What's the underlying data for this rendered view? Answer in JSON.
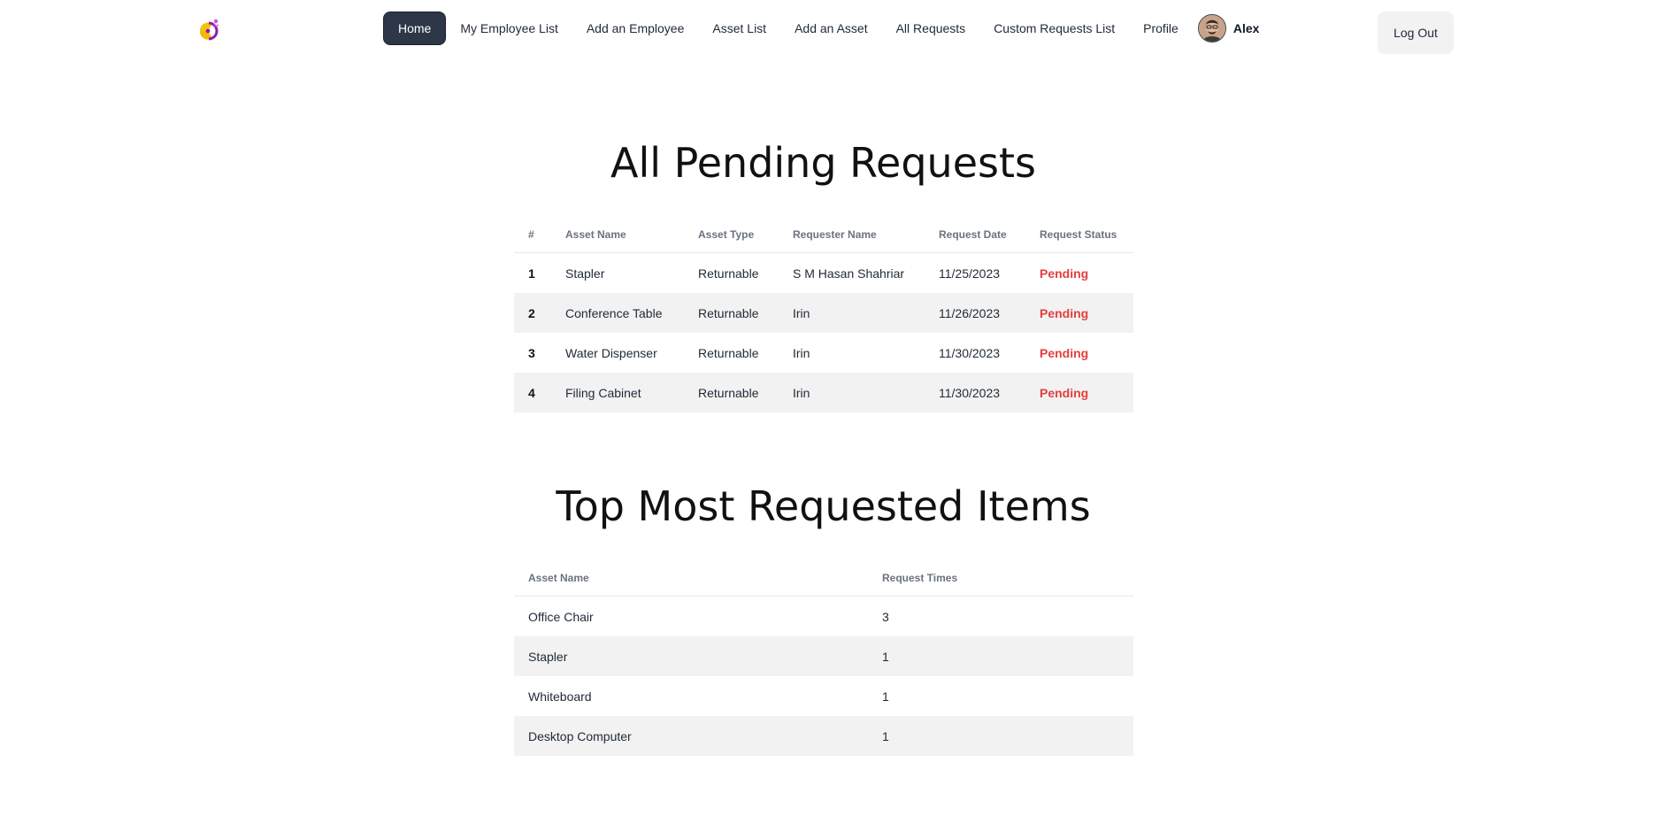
{
  "nav": {
    "items": [
      {
        "label": "Home",
        "active": true
      },
      {
        "label": "My Employee List"
      },
      {
        "label": "Add an Employee"
      },
      {
        "label": "Asset List"
      },
      {
        "label": "Add an Asset"
      },
      {
        "label": "All Requests"
      },
      {
        "label": "Custom Requests List"
      },
      {
        "label": "Profile"
      }
    ],
    "user_name": "Alex",
    "logout_label": "Log Out"
  },
  "pending": {
    "title": "All Pending Requests",
    "headers": [
      "#",
      "Asset Name",
      "Asset Type",
      "Requester Name",
      "Request Date",
      "Request Status"
    ],
    "rows": [
      {
        "num": "1",
        "asset": "Stapler",
        "type": "Returnable",
        "requester": "S M Hasan Shahriar",
        "date": "11/25/2023",
        "status": "Pending"
      },
      {
        "num": "2",
        "asset": "Conference Table",
        "type": "Returnable",
        "requester": "Irin",
        "date": "11/26/2023",
        "status": "Pending"
      },
      {
        "num": "3",
        "asset": "Water Dispenser",
        "type": "Returnable",
        "requester": "Irin",
        "date": "11/30/2023",
        "status": "Pending"
      },
      {
        "num": "4",
        "asset": "Filing Cabinet",
        "type": "Returnable",
        "requester": "Irin",
        "date": "11/30/2023",
        "status": "Pending"
      }
    ]
  },
  "top": {
    "title": "Top Most Requested Items",
    "headers": [
      "Asset Name",
      "Request Times"
    ],
    "rows": [
      {
        "asset": "Office Chair",
        "times": "3"
      },
      {
        "asset": "Stapler",
        "times": "1"
      },
      {
        "asset": "Whiteboard",
        "times": "1"
      },
      {
        "asset": "Desktop Computer",
        "times": "1"
      }
    ]
  },
  "colors": {
    "active_nav": "#2d3748",
    "status_pending": "#e53e3e",
    "row_alt": "#f2f2f2"
  }
}
